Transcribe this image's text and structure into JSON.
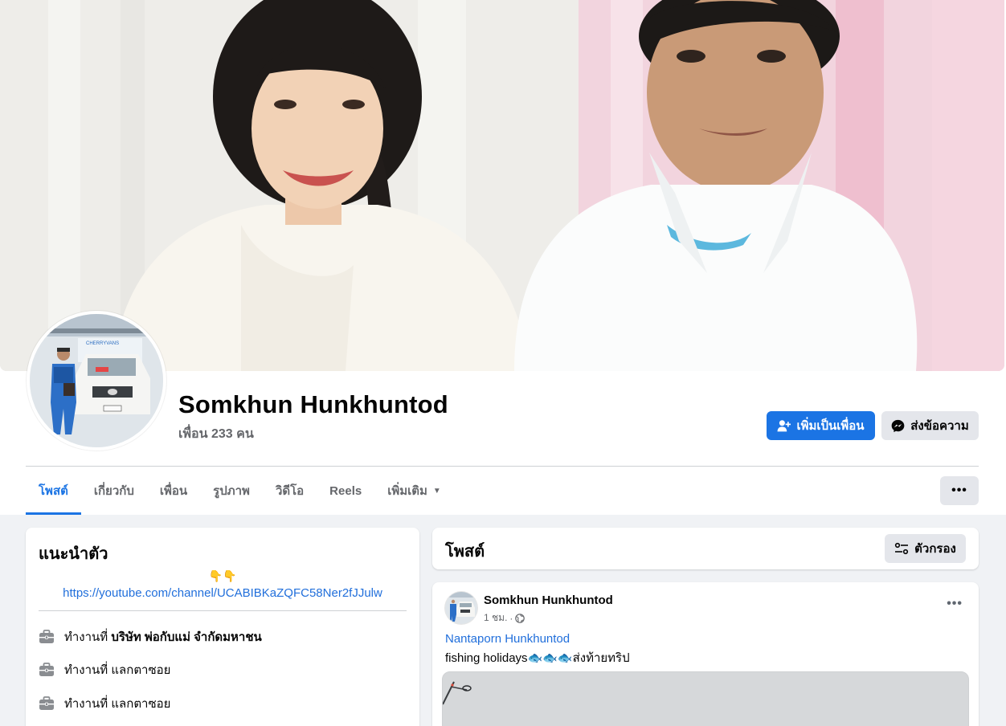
{
  "profile": {
    "name": "Somkhun Hunkhuntod",
    "friends_count": "เพื่อน 233 คน"
  },
  "actions": {
    "add_friend_label": "เพิ่มเป็นเพื่อน",
    "message_label": "ส่งข้อความ",
    "more_label": "•••"
  },
  "tabs": [
    {
      "label": "โพสต์",
      "active": true
    },
    {
      "label": "เกี่ยวกับ"
    },
    {
      "label": "เพื่อน"
    },
    {
      "label": "รูปภาพ"
    },
    {
      "label": "วิดีโอ"
    },
    {
      "label": "Reels"
    },
    {
      "label": "เพิ่มเติม"
    }
  ],
  "intro": {
    "title": "แนะนำตัว",
    "emoji": "👇👇",
    "link": "https://youtube.com/channel/UCABIBKaZQFC58Ner2fJJulw",
    "work": [
      {
        "prefix": "ทำงานที่",
        "place": "บริษัท พ่อกับแม่ จำกัดมหาชน",
        "bold": true
      },
      {
        "prefix": "ทำงานที่",
        "place": "แลกตาซอย",
        "bold": false
      },
      {
        "prefix": "ทำงานที่",
        "place": "แลกตาซอย",
        "bold": false
      }
    ]
  },
  "posts_section": {
    "title": "โพสต์",
    "filter_label": "ตัวกรอง"
  },
  "post": {
    "author": "Somkhun Hunkhuntod",
    "time": "1 ชม.",
    "tag": "Nantaporn Hunkhuntod",
    "text": "fishing holidays🐟🐟🐟ส่งท้ายทริป",
    "options_label": "•••"
  },
  "colors": {
    "primary": "#1b74e4",
    "link": "#216fdb",
    "secondary_text": "#65676b",
    "button_grey": "#e4e6eb",
    "background": "#f0f2f5"
  }
}
